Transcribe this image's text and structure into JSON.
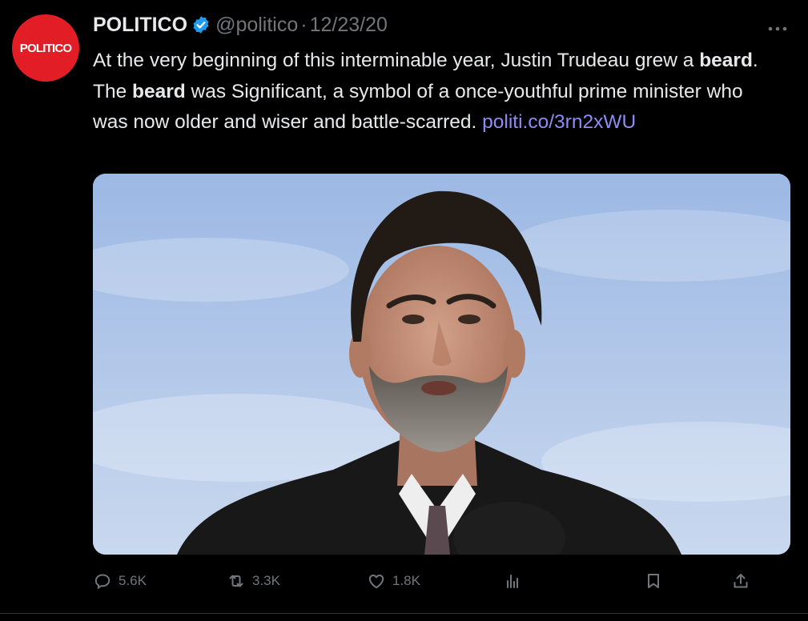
{
  "author": {
    "avatar_text": "POLITICO",
    "display_name": "POLITICO",
    "handle": "@politico",
    "separator": "·",
    "date": "12/23/20"
  },
  "tweet": {
    "text_1": "At the very beginning of this interminable year, Justin Trudeau grew a ",
    "bold_1": "beard",
    "text_2": ". The ",
    "bold_2": "beard",
    "text_3": " was Significant, a symbol of a once-youthful prime minister who was now older and wiser and battle-scarred. ",
    "link": "politi.co/​3rn2xWU"
  },
  "actions": {
    "replies": "5.6K",
    "retweets": "3.3K",
    "likes": "1.8K"
  },
  "icons": {
    "verified": "verified-badge-icon",
    "more": "more-dots-icon",
    "reply": "reply-icon",
    "retweet": "retweet-icon",
    "like": "heart-icon",
    "views": "analytics-icon",
    "bookmark": "bookmark-icon",
    "share": "share-icon"
  },
  "colors": {
    "background": "#000000",
    "text": "#e7e9ea",
    "secondary": "#71767b",
    "link": "#8e8cf4",
    "verified": "#1d9bf0",
    "brand": "#e31d25"
  }
}
